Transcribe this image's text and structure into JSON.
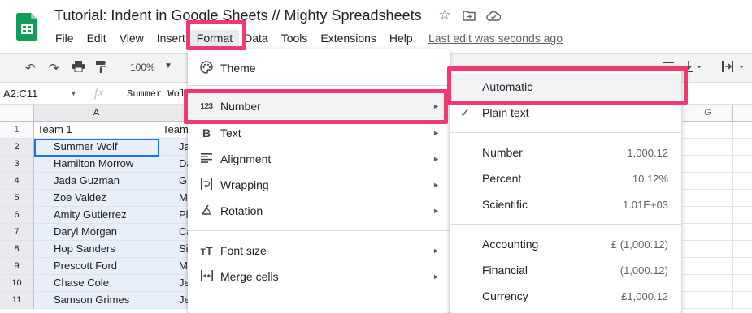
{
  "header": {
    "title": "Tutorial: Indent in Google Sheets // Mighty Spreadsheets",
    "icons": [
      "star-icon",
      "move-to-folder-icon",
      "cloud-status-icon"
    ],
    "last_edit": "Last edit was seconds ago"
  },
  "menubar": {
    "items": [
      "File",
      "Edit",
      "View",
      "Insert",
      "Format",
      "Data",
      "Tools",
      "Extensions",
      "Help"
    ],
    "active": "Format"
  },
  "toolbar": {
    "zoom": "100%"
  },
  "formula_bar": {
    "namebox": "A2:C11",
    "fx": "fx",
    "value": "Summer Wolf"
  },
  "grid": {
    "columns": [
      "A",
      "G"
    ],
    "rows": [
      "1",
      "2",
      "3",
      "4",
      "5",
      "6",
      "7",
      "8",
      "9",
      "10",
      "11"
    ],
    "col_a": [
      "Team 1",
      "Summer Wolf",
      "Hamilton Morrow",
      "Jada Guzman",
      "Zoe Valdez",
      "Amity Gutierrez",
      "Daryl Morgan",
      "Hop Sanders",
      "Prescott Ford",
      "Chase Cole",
      "Samson Grimes"
    ],
    "col_b": [
      "Team",
      "Ja",
      "Da",
      "G",
      "M",
      "Pl",
      "Ca",
      "Si",
      "M",
      "Je",
      "Je"
    ]
  },
  "format_menu": {
    "items": [
      {
        "icon": "palette-icon",
        "label": "Theme"
      },
      {
        "icon": "number-format-icon",
        "label": "Number",
        "glyph": "123"
      },
      {
        "icon": "bold-icon",
        "label": "Text"
      },
      {
        "icon": "align-icon",
        "label": "Alignment"
      },
      {
        "icon": "wrap-icon",
        "label": "Wrapping"
      },
      {
        "icon": "rotate-icon",
        "label": "Rotation"
      },
      {
        "icon": "font-size-icon",
        "label": "Font size"
      },
      {
        "icon": "merge-icon",
        "label": "Merge cells"
      }
    ]
  },
  "number_submenu": {
    "items": [
      {
        "label": "Automatic",
        "value": ""
      },
      {
        "label": "Plain text",
        "value": "",
        "checked": true
      },
      {
        "label": "Number",
        "value": "1,000.12"
      },
      {
        "label": "Percent",
        "value": "10.12%"
      },
      {
        "label": "Scientific",
        "value": "1.01E+03"
      },
      {
        "label": "Accounting",
        "value": "£ (1,000.12)"
      },
      {
        "label": "Financial",
        "value": "(1,000.12)"
      },
      {
        "label": "Currency",
        "value": "£1,000.12"
      }
    ]
  },
  "colors": {
    "highlight": "#f2386f",
    "selection": "#e8eefa",
    "active_border": "#1a73e8",
    "sheets_green": "#0f9d58"
  }
}
